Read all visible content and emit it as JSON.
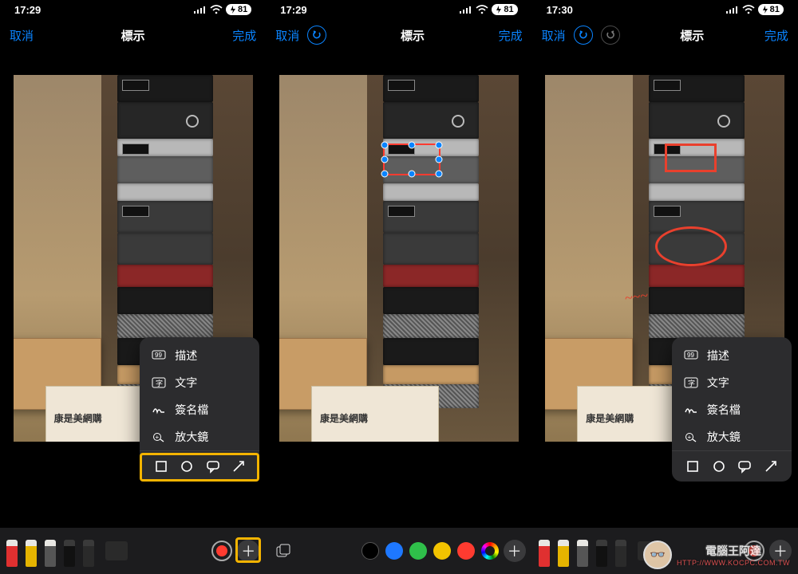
{
  "panels": [
    {
      "time": "17:29",
      "battery": "81",
      "cancel": "取消",
      "title": "標示",
      "done": "完成",
      "show_undo": false,
      "undo_dim": false,
      "popup": true,
      "popup_highlight": true,
      "plus_highlight": true,
      "toolbar_mode": "pens"
    },
    {
      "time": "17:29",
      "battery": "81",
      "cancel": "取消",
      "title": "標示",
      "done": "完成",
      "show_undo": true,
      "undo_dim": false,
      "popup": false,
      "toolbar_mode": "layers_colors",
      "selection_rect": true
    },
    {
      "time": "17:30",
      "battery": "81",
      "cancel": "取消",
      "title": "標示",
      "done": "完成",
      "show_undo": true,
      "undo_dim": true,
      "popup": true,
      "popup_highlight": false,
      "toolbar_mode": "pens",
      "annotations": true
    }
  ],
  "popup_menu": {
    "items": [
      {
        "icon": "quote-icon",
        "label": "描述"
      },
      {
        "icon": "text-icon",
        "label": "文字"
      },
      {
        "icon": "signature-icon",
        "label": "簽名檔"
      },
      {
        "icon": "magnifier-icon",
        "label": "放大鏡"
      }
    ],
    "shapes": [
      "square",
      "circle",
      "speech",
      "arrow"
    ]
  },
  "toolbar": {
    "colors_row": [
      "#000000",
      "#1e78ff",
      "#2fbf4a",
      "#f2c300",
      "#ff3b30"
    ],
    "accent": "#ff3b30"
  },
  "photo_box_label": "康是美網購",
  "watermark": {
    "line1": "電腦王阿達",
    "line2": "HTTP://WWW.KOCPC.COM.TW"
  }
}
